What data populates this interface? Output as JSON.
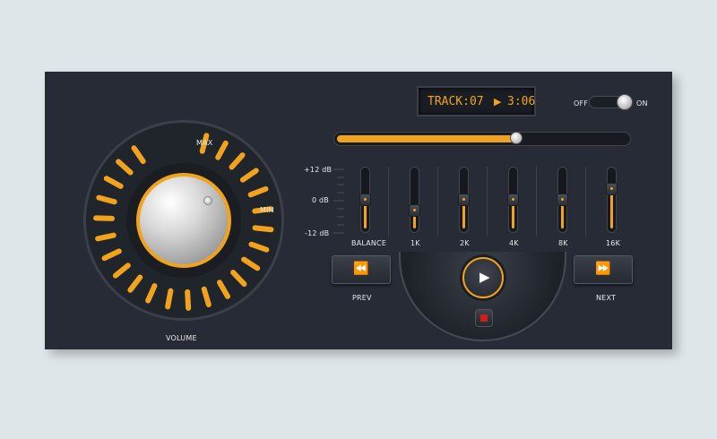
{
  "display": {
    "track": "TRACK:07",
    "play_symbol": "▶",
    "time": "3:06"
  },
  "power": {
    "off_label": "OFF",
    "on_label": "ON",
    "state": "on"
  },
  "progress": {
    "fraction": 0.62
  },
  "equalizer": {
    "scale": {
      "top": "+12 dB",
      "mid": "0 dB",
      "bottom": "-12 dB"
    },
    "bands": [
      {
        "label": "BALANCE",
        "level": 0.5
      },
      {
        "label": "1K",
        "level": 0.3
      },
      {
        "label": "2K",
        "level": 0.5
      },
      {
        "label": "4K",
        "level": 0.5
      },
      {
        "label": "8K",
        "level": 0.5
      },
      {
        "label": "16K",
        "level": 0.7
      }
    ]
  },
  "volume": {
    "label": "VOLUME",
    "max_label": "MAX",
    "min_label": "MIN"
  },
  "transport": {
    "prev_label": "PREV",
    "prev_icon": "⏪",
    "next_label": "NEXT",
    "next_icon": "⏩",
    "play_icon": "▶"
  },
  "colors": {
    "accent": "#f2a31d",
    "panel": "#262b35",
    "stop": "#d21d1d"
  }
}
